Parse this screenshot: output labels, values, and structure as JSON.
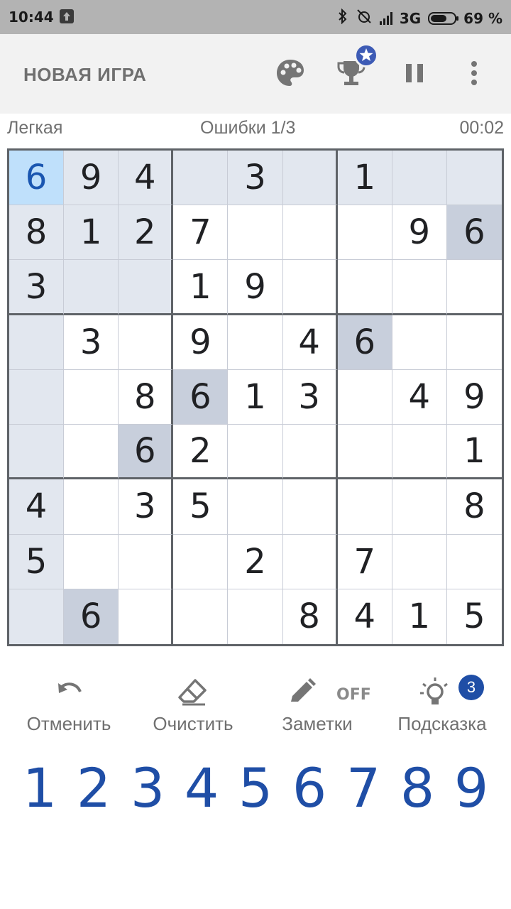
{
  "status_bar": {
    "time": "10:44",
    "network": "3G",
    "battery": "69 %",
    "battery_level": 0.69
  },
  "app_bar": {
    "title": "НОВАЯ ИГРА",
    "icons": [
      "palette-icon",
      "trophy-icon",
      "star-badge-icon",
      "pause-icon",
      "more-vert-icon"
    ]
  },
  "info": {
    "difficulty": "Легкая",
    "mistakes": "Ошибки 1/3",
    "timer": "00:02"
  },
  "board": {
    "rows": [
      [
        "6",
        "9",
        "4",
        "",
        "3",
        "",
        "1",
        "",
        ""
      ],
      [
        "8",
        "1",
        "2",
        "7",
        "",
        "",
        "",
        "9",
        "6"
      ],
      [
        "3",
        "",
        "",
        "1",
        "9",
        "",
        "",
        "",
        ""
      ],
      [
        "",
        "3",
        "",
        "9",
        "",
        "4",
        "6",
        "",
        ""
      ],
      [
        "",
        "",
        "8",
        "6",
        "1",
        "3",
        "",
        "4",
        "9"
      ],
      [
        "",
        "",
        "6",
        "2",
        "",
        "",
        "",
        "",
        "1"
      ],
      [
        "4",
        "",
        "3",
        "5",
        "",
        "",
        "",
        "",
        "8"
      ],
      [
        "5",
        "",
        "",
        "",
        "2",
        "",
        "7",
        "",
        ""
      ],
      [
        "",
        "6",
        "",
        "",
        "",
        "8",
        "4",
        "1",
        "5"
      ]
    ],
    "selected": [
      0,
      0
    ],
    "colors": {
      "selected": "#bfe0fb",
      "related": "#e2e7ef",
      "same_number": "#c8cfdc",
      "accent": "#1f4ea6"
    }
  },
  "tools": {
    "undo": "Отменить",
    "erase": "Очистить",
    "notes": "Заметки",
    "notes_state": "OFF",
    "hint": "Подсказка",
    "hint_count": "3"
  },
  "numpad": [
    "1",
    "2",
    "3",
    "4",
    "5",
    "6",
    "7",
    "8",
    "9"
  ]
}
